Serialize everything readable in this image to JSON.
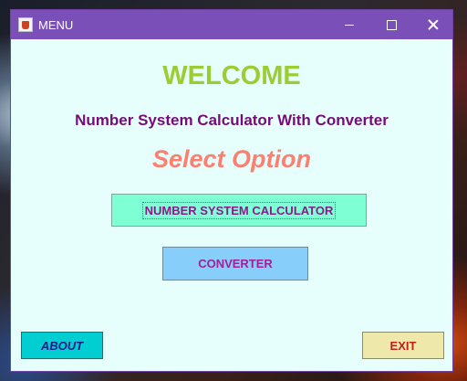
{
  "window": {
    "title": "MENU",
    "icon": "java-cup-icon",
    "controls": [
      "minimize-icon",
      "maximize-icon",
      "close-icon"
    ]
  },
  "content": {
    "welcome": "WELCOME",
    "subtitle": "Number System Calculator With Converter",
    "prompt": "Select Option"
  },
  "buttons": {
    "calculator": "NUMBER SYSTEM CALCULATOR",
    "converter": "CONVERTER",
    "about": "ABOUT",
    "exit": "EXIT"
  },
  "colors": {
    "titlebar": "#7a4fb8",
    "background": "#e6fffc",
    "welcome": "#9acd32",
    "subtitle": "#7a0a7a",
    "prompt": "#fa8072",
    "calculator_button": "#7fffd4",
    "converter_button": "#87cefa",
    "about_button": "#00ced1",
    "exit_button": "#eee8aa"
  }
}
